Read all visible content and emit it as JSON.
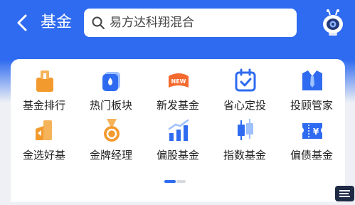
{
  "header": {
    "title": "基金",
    "search_text": "易方达科翔混合"
  },
  "menu": {
    "items": [
      {
        "label": "基金排行",
        "icon": "ranking-icon"
      },
      {
        "label": "热门板块",
        "icon": "hot-sector-icon"
      },
      {
        "label": "新发基金",
        "icon": "new-fund-icon",
        "badge": "NEW"
      },
      {
        "label": "省心定投",
        "icon": "calendar-check-icon"
      },
      {
        "label": "投顾管家",
        "icon": "advisor-icon"
      },
      {
        "label": "金选好基",
        "icon": "gold-pick-icon"
      },
      {
        "label": "金牌经理",
        "icon": "medal-icon"
      },
      {
        "label": "偏股基金",
        "icon": "bar-chart-icon"
      },
      {
        "label": "指数基金",
        "icon": "candlestick-icon"
      },
      {
        "label": "偏债基金",
        "icon": "bond-ticket-icon",
        "badge": "¥"
      }
    ]
  },
  "colors": {
    "primary": "#2f6bf0",
    "accent": "#f39a2e",
    "background": "#eef0f5"
  }
}
